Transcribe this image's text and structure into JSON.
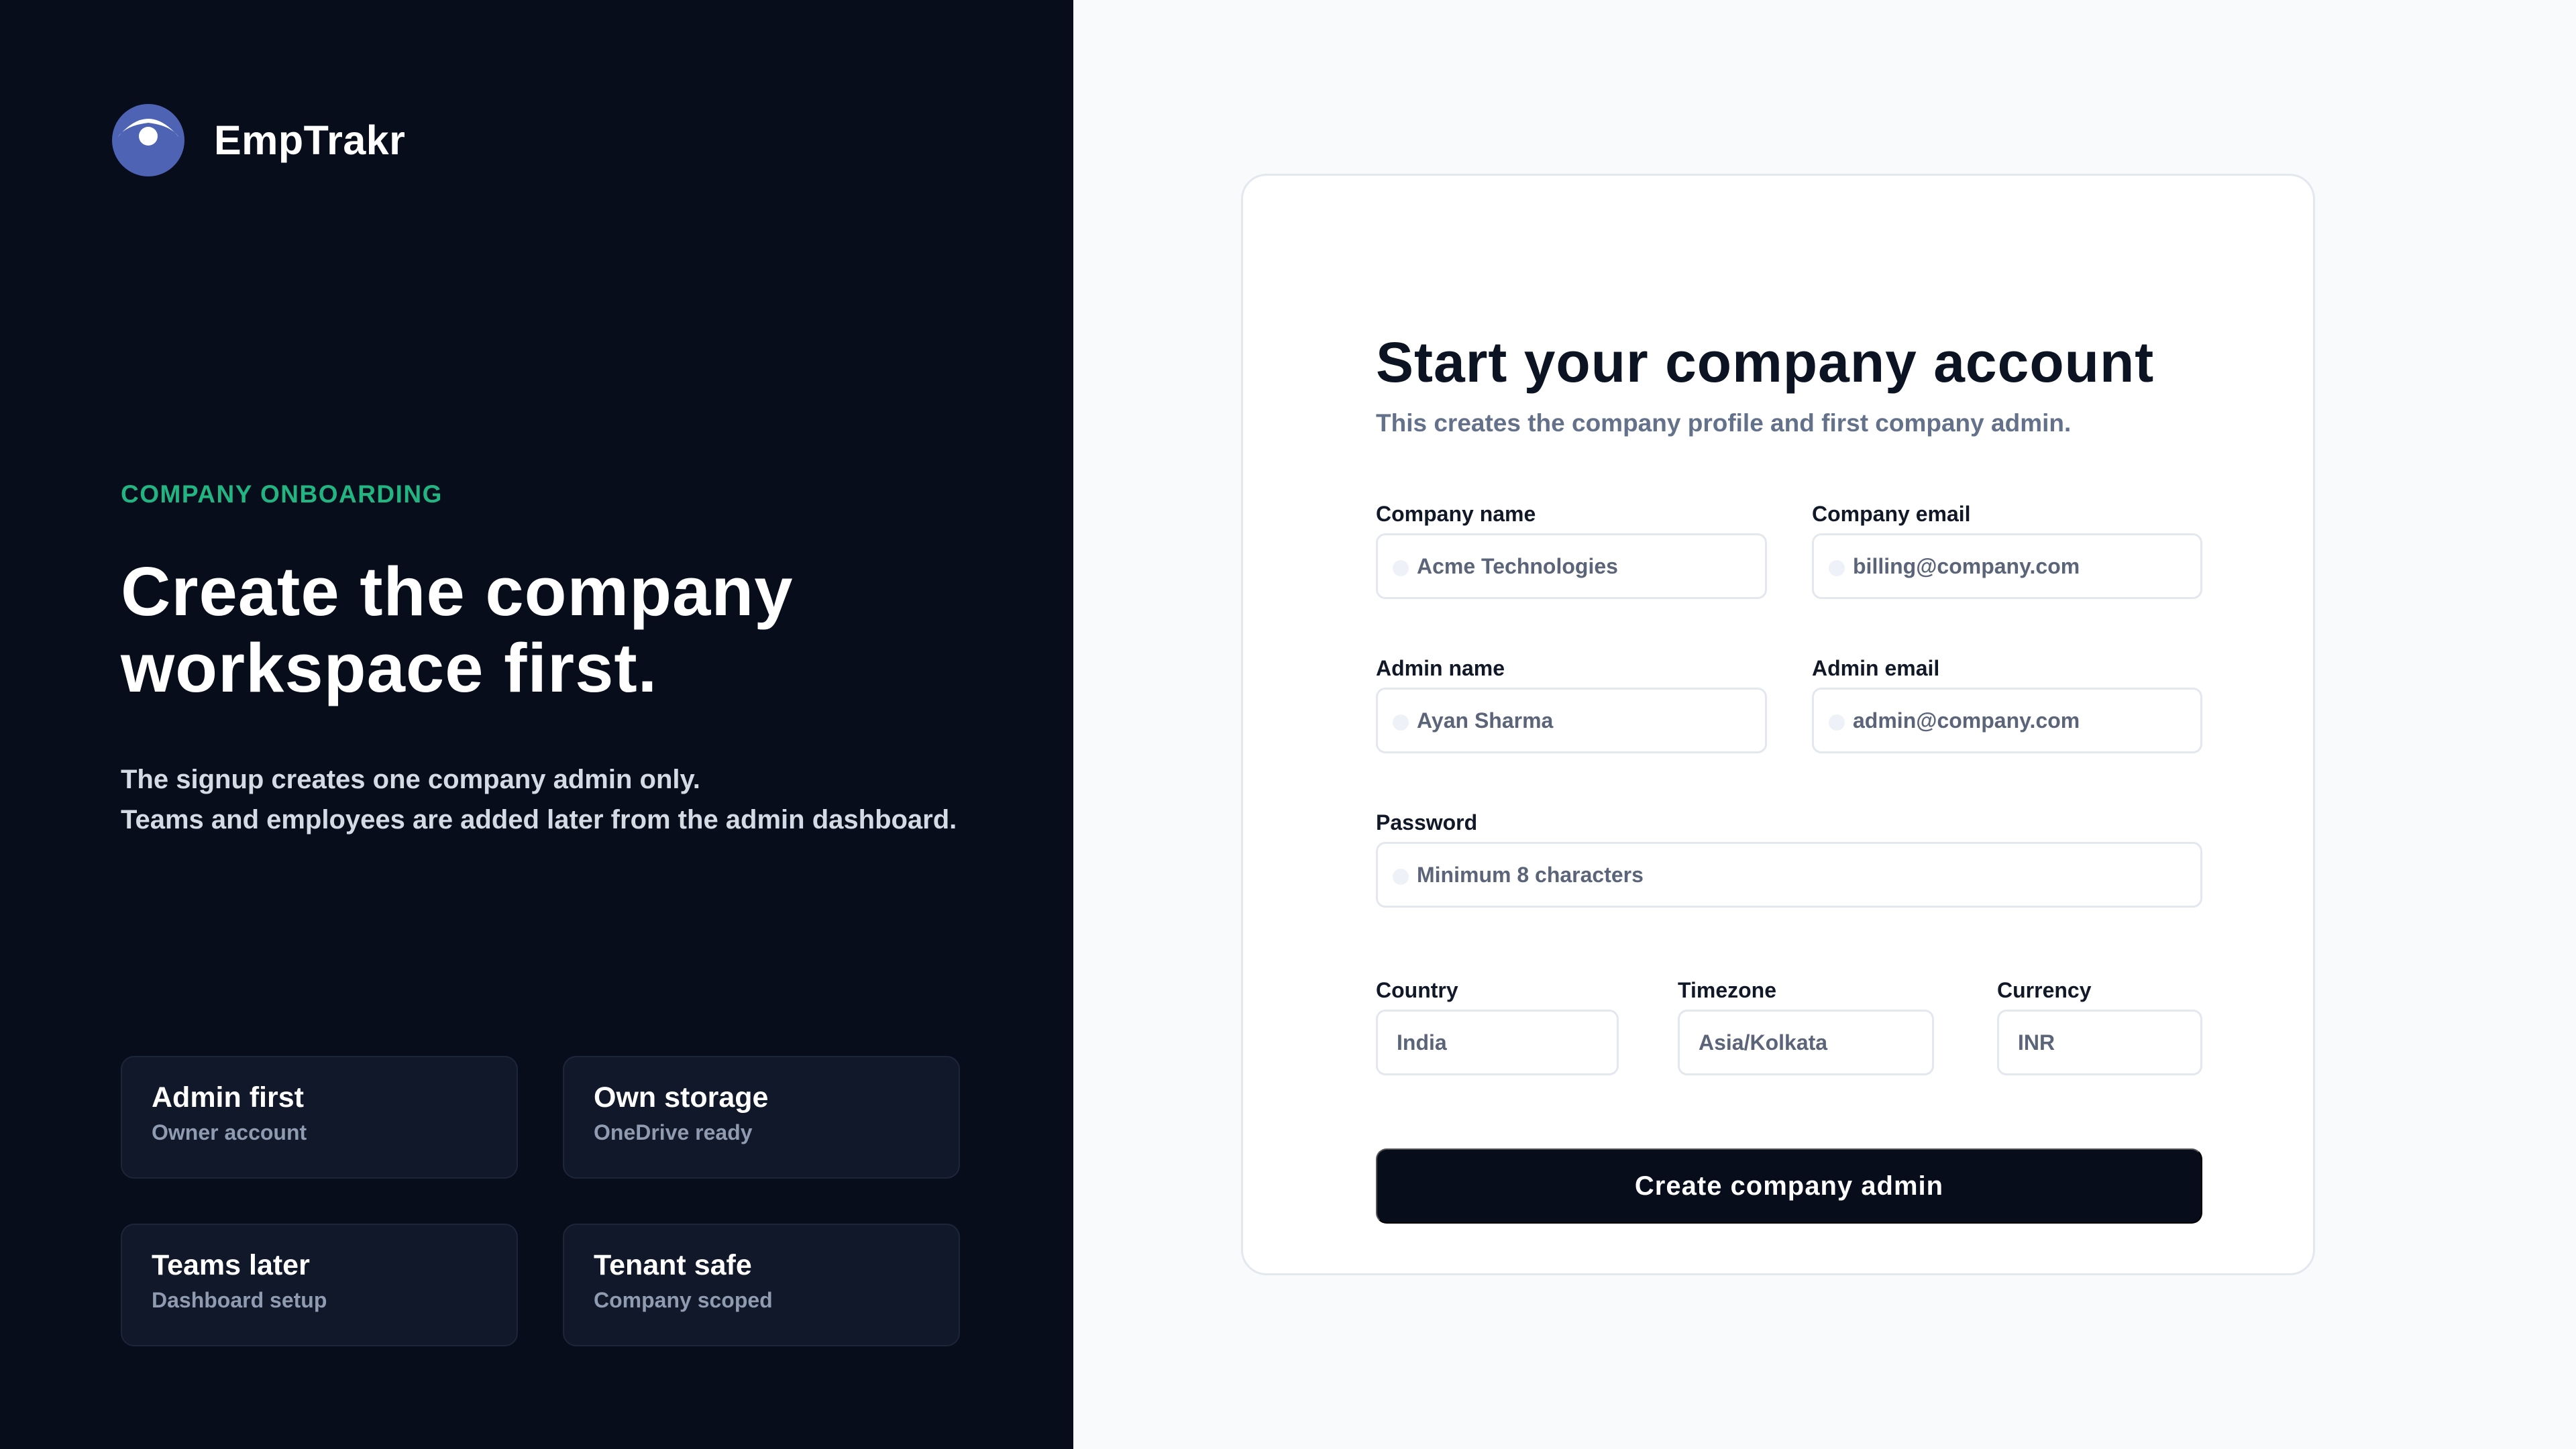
{
  "brand": {
    "name": "EmpTrakr",
    "logo_icon": "eye-logo-icon",
    "accent": "#4f63b5"
  },
  "hero": {
    "eyebrow": "COMPANY ONBOARDING",
    "title": "Create the company workspace first.",
    "description_line1": "The signup creates one company admin only.",
    "description_line2": "Teams and employees are added later from the admin dashboard.",
    "eyebrow_color": "#22b582"
  },
  "features": [
    {
      "title": "Admin first",
      "subtitle": "Owner account"
    },
    {
      "title": "Own storage",
      "subtitle": "OneDrive ready"
    },
    {
      "title": "Teams later",
      "subtitle": "Dashboard setup"
    },
    {
      "title": "Tenant safe",
      "subtitle": "Company scoped"
    }
  ],
  "form": {
    "title": "Start your company account",
    "subtitle": "This creates the company profile and first company admin.",
    "company_name": {
      "label": "Company name",
      "placeholder": "Acme Technologies"
    },
    "company_email": {
      "label": "Company email",
      "placeholder": "billing@company.com"
    },
    "admin_name": {
      "label": "Admin name",
      "placeholder": "Ayan Sharma"
    },
    "admin_email": {
      "label": "Admin email",
      "placeholder": "admin@company.com"
    },
    "password": {
      "label": "Password",
      "placeholder": "Minimum 8 characters"
    },
    "country": {
      "label": "Country",
      "value": "India"
    },
    "timezone": {
      "label": "Timezone",
      "value": "Asia/Kolkata"
    },
    "currency": {
      "label": "Currency",
      "value": "INR"
    },
    "submit_label": "Create company admin"
  }
}
